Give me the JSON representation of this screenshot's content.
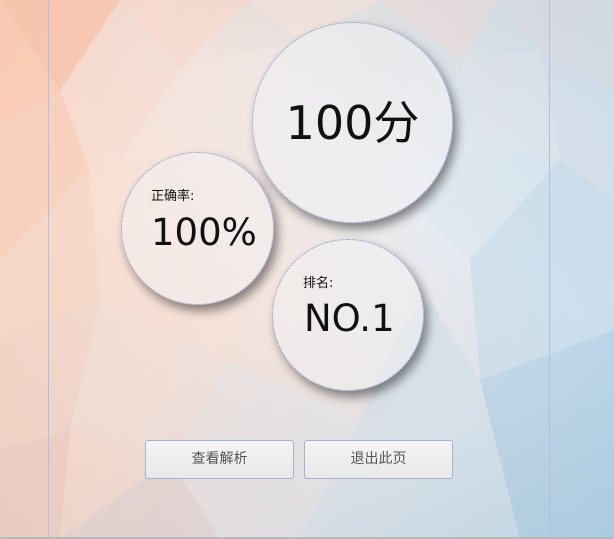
{
  "result": {
    "score": "100分",
    "accuracy_label": "正确率:",
    "accuracy_value": "100%",
    "rank_label": "排名:",
    "rank_value": "NO.1"
  },
  "actions": {
    "analysis_label": "查看解析",
    "exit_label": "退出此页"
  }
}
